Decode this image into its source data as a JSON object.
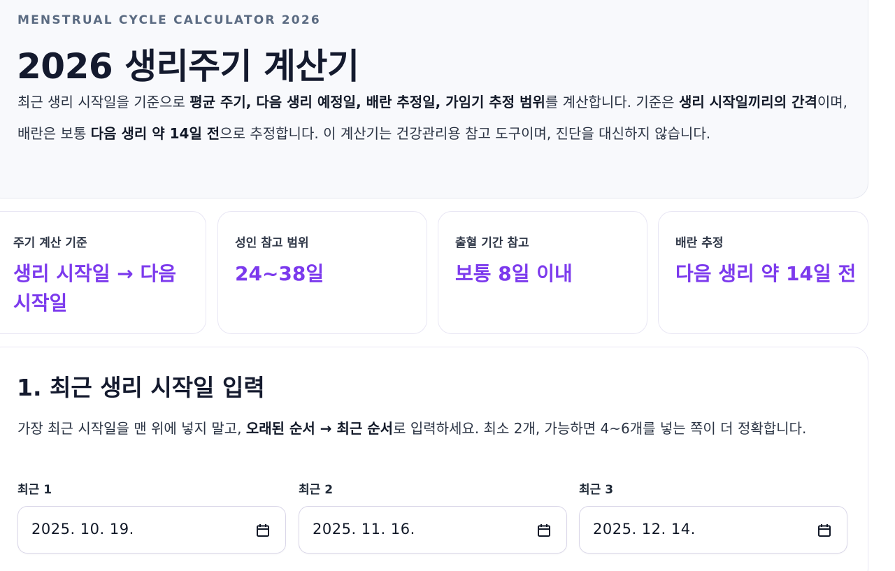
{
  "hero": {
    "eyebrow": "MENSTRUAL CYCLE CALCULATOR 2026",
    "title": "2026 생리주기 계산기",
    "intro": {
      "p1": "최근 생리 시작일을 기준으로 ",
      "b1": "평균 주기, 다음 생리 예정일, 배란 추정일, 가임기 추정 범위",
      "p2": "를 계산합니다. 기준은 ",
      "b2": "생리 시작일끼리의 간격",
      "p3": "이며, 배란은 보통 ",
      "b3": "다음 생리 약 14일 전",
      "p4": "으로 추정합니다. 이 계산기는 건강관리용 참고 도구이며, 진단을 대신하지 않습니다."
    }
  },
  "stats": [
    {
      "label": "주기 계산 기준",
      "value": "생리 시작일 → 다음 시작일"
    },
    {
      "label": "성인 참고 범위",
      "value": "24~38일"
    },
    {
      "label": "출혈 기간 참고",
      "value": "보통 8일 이내"
    },
    {
      "label": "배란 추정",
      "value": "다음 생리 약 14일 전"
    }
  ],
  "section1": {
    "title": "1. 최근 생리 시작일 입력",
    "desc": {
      "p1": "가장 최근 시작일을 맨 위에 넣지 말고, ",
      "b1": "오래된 순서 → 최근 순서",
      "p2": "로 입력하세요. 최소 2개, 가능하면 4~6개를 넣는 쪽이 더 정확합니다."
    },
    "fields": [
      {
        "label": "최근 1",
        "value": "2025. 10. 19.",
        "icon": "calendar-icon"
      },
      {
        "label": "최근 2",
        "value": "2025. 11. 16.",
        "icon": "calendar-icon"
      },
      {
        "label": "최근 3",
        "value": "2025. 12. 14.",
        "icon": "calendar-icon"
      }
    ]
  },
  "colors": {
    "accent": "#7c3aed",
    "heading": "#141a2e",
    "eyebrow": "#5b6b82",
    "hero_bg": "#f8f9fc"
  }
}
